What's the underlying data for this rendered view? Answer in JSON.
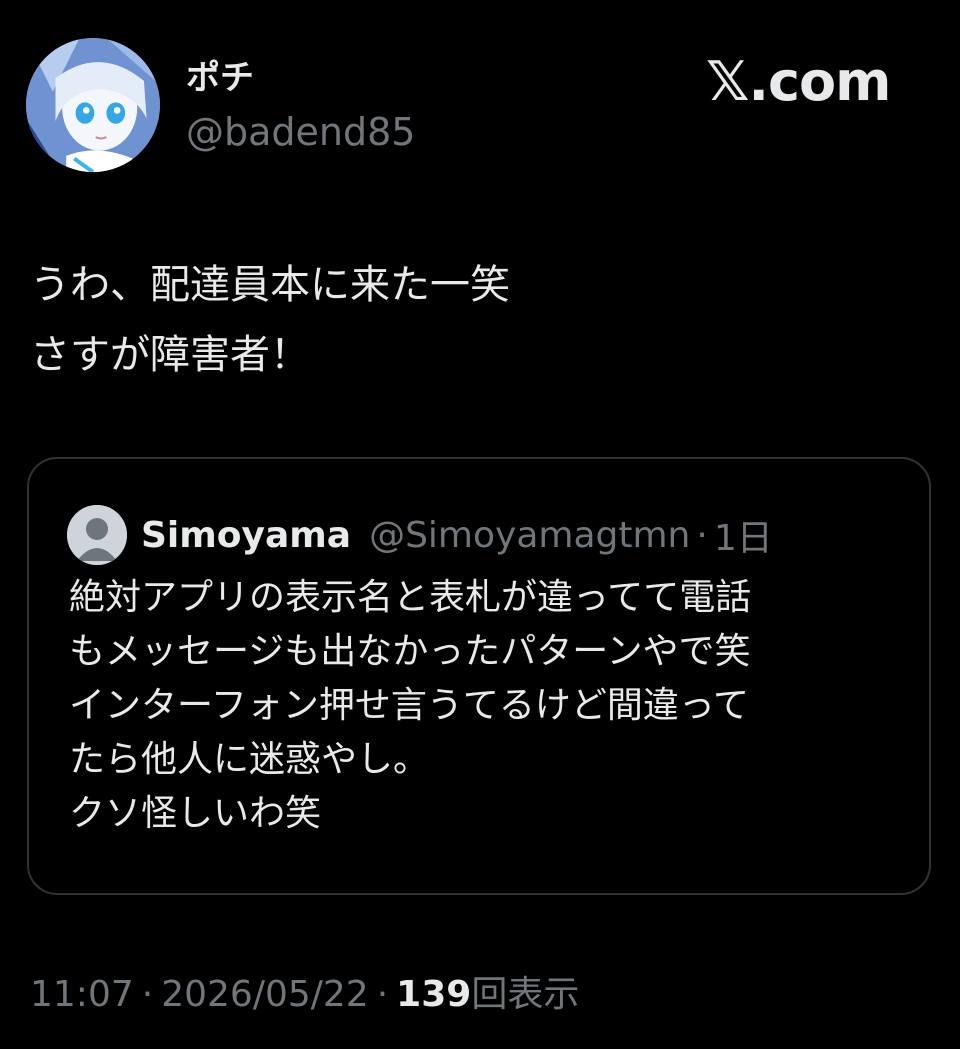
{
  "author": {
    "display_name": "ポチ",
    "handle": "@badend85",
    "avatar_icon": "anime-avatar-icon"
  },
  "site_logo": "𝕏.com",
  "tweet": {
    "lines": [
      "うわ、配達員本に来た一笑",
      "さすが障害者！"
    ]
  },
  "quote": {
    "avatar_icon": "default-user-icon",
    "name": "Simoyama",
    "handle": "@Simoyamagtmn",
    "separator": "·",
    "time": "1日",
    "lines": [
      "絶対アプリの表示名と表札が違ってて電話",
      "もメッセージも出なかったパターンやで笑",
      "インターフォン押せ言うてるけど間違って",
      "たら他人に迷惑やし。",
      "クソ怪しいわ笑"
    ]
  },
  "meta": {
    "time": "11:07",
    "separator": "·",
    "date": "2026/05/22",
    "views_count": "139",
    "views_label": "回表示"
  },
  "colors": {
    "background": "#000000",
    "text_primary": "#e7e9ea",
    "text_secondary": "#71767b",
    "border": "#2f3336"
  }
}
